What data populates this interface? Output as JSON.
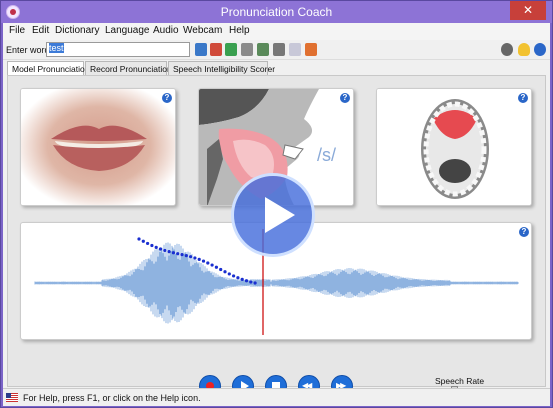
{
  "window": {
    "title": "Pronunciation Coach",
    "close_glyph": "✕"
  },
  "menu": [
    "File",
    "Edit",
    "Dictionary",
    "Language",
    "Audio",
    "Webcam",
    "Help"
  ],
  "toolbar": {
    "enter_word_label": "Enter word:",
    "word_value": "test"
  },
  "tabs": [
    "Model Pronunciation",
    "Record Pronunciation",
    "Speech Intelligibility Scorer"
  ],
  "active_tab": 0,
  "panels": {
    "phoneme_label": "/s/",
    "help_glyph": "?"
  },
  "speech_rate": {
    "label": "Speech Rate",
    "minus": "-",
    "plus": "+"
  },
  "status": {
    "text": "For Help, press F1, or click on the Help icon."
  },
  "colors": {
    "titlebar": "#8d73d6",
    "accent_blue": "#1f6ed8",
    "waveform": "#8fb3e0",
    "pitch_dots": "#1a2fd0",
    "cursor_line": "#cc0000"
  }
}
